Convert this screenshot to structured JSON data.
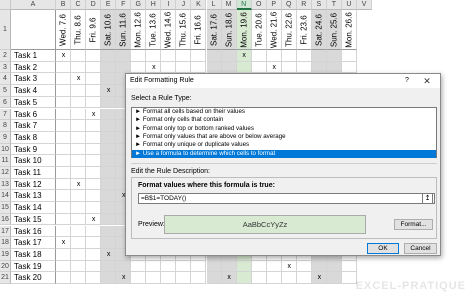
{
  "sheet": {
    "col_letters": [
      "A",
      "B",
      "C",
      "D",
      "E",
      "F",
      "G",
      "H",
      "I",
      "J",
      "K",
      "L",
      "M",
      "N",
      "O",
      "P",
      "Q",
      "R",
      "S",
      "T",
      "U",
      "V"
    ],
    "row_numbers": [
      "1",
      "2",
      "3",
      "4",
      "5",
      "6",
      "7",
      "8",
      "9",
      "10",
      "11",
      "12",
      "13",
      "14",
      "15",
      "16",
      "17",
      "18",
      "19",
      "20",
      "21"
    ],
    "dates": [
      "Wed. 7.6",
      "Thu. 8.6",
      "Fri. 9.6",
      "Sat. 10.6",
      "Sun. 11.6",
      "Mon. 12.6",
      "Tue. 13.6",
      "Wed. 14.6",
      "Thu. 15.6",
      "Fri. 16.6",
      "Sat. 17.6",
      "Sun. 18.6",
      "Mon. 19.6",
      "Tue. 20.6",
      "Wed. 21.6",
      "Thu. 22.6",
      "Fri. 23.6",
      "Sat. 24.6",
      "Sun. 25.6",
      "Mon. 26.6"
    ],
    "selected_col": "N",
    "tasks": [
      "Task 1",
      "Task 2",
      "Task 3",
      "Task 4",
      "Task 5",
      "Task 6",
      "Task 7",
      "Task 8",
      "Task 9",
      "Task 10",
      "Task 11",
      "Task 12",
      "Task 13",
      "Task 14",
      "Task 15",
      "Task 16",
      "Task 17",
      "Task 18",
      "Task 19",
      "Task 20"
    ],
    "mark": "x",
    "marks": [
      [
        0,
        0
      ],
      [
        0,
        12
      ],
      [
        1,
        6
      ],
      [
        1,
        14
      ],
      [
        2,
        1
      ],
      [
        3,
        3
      ],
      [
        4,
        5
      ],
      [
        5,
        2
      ],
      [
        6,
        7
      ],
      [
        7,
        5
      ],
      [
        7,
        14
      ],
      [
        9,
        6
      ],
      [
        10,
        8
      ],
      [
        11,
        1
      ],
      [
        11,
        11
      ],
      [
        12,
        4
      ],
      [
        13,
        10
      ],
      [
        14,
        2
      ],
      [
        16,
        0
      ],
      [
        16,
        5
      ],
      [
        17,
        3
      ],
      [
        18,
        15
      ],
      [
        19,
        4
      ],
      [
        19,
        11
      ],
      [
        19,
        17
      ]
    ],
    "colors": {
      "weekend": "#d9d9d9",
      "today": "#d9ead3",
      "accent": "#217346"
    }
  },
  "dialog": {
    "title": "Edit Formatting Rule",
    "help": "?",
    "close": "✕",
    "select_rule_type": "Select a Rule Type:",
    "rule_types": [
      "► Format all cells based on their values",
      "► Format only cells that contain",
      "► Format only top or bottom ranked values",
      "► Format only values that are above or below average",
      "► Format only unique or duplicate values",
      "► Use a formula to determine which cells to format"
    ],
    "selected_rule_index": 5,
    "edit_rule_description": "Edit the Rule Description:",
    "format_values_label": "Format values where this formula is true:",
    "formula_value": "=B$1=TODAY()",
    "ref_icon": "↥",
    "preview_label": "Preview:",
    "preview_sample": "AaBbCcYyZz",
    "format_button": "Format...",
    "ok_button": "OK",
    "cancel_button": "Cancel",
    "accent": "#0078d7"
  },
  "watermark": "EXCEL-PRATIQUE"
}
